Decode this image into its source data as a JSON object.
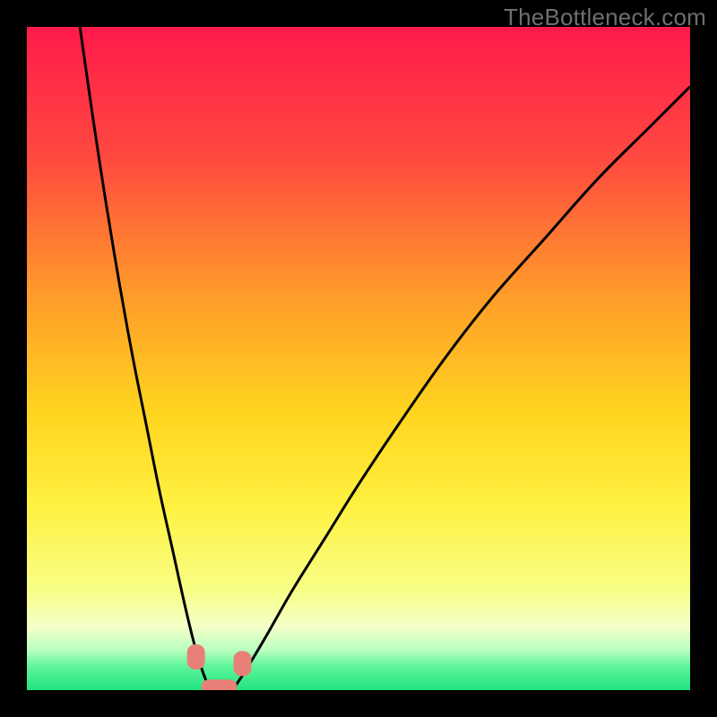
{
  "watermark": "TheBottleneck.com",
  "chart_data": {
    "type": "line",
    "title": "",
    "xlabel": "",
    "ylabel": "",
    "xlim": [
      0,
      100
    ],
    "ylim": [
      0,
      100
    ],
    "grid": false,
    "legend": false,
    "series": [
      {
        "name": "left-curve",
        "x": [
          8,
          10,
          12,
          14,
          16,
          18,
          20,
          22,
          24,
          25.5,
          27,
          28
        ],
        "y": [
          100,
          86,
          73,
          61,
          50,
          40,
          30,
          21,
          12,
          6,
          1.5,
          0
        ]
      },
      {
        "name": "right-curve",
        "x": [
          31,
          33,
          36,
          40,
          45,
          50,
          56,
          63,
          70,
          78,
          86,
          94,
          100
        ],
        "y": [
          0,
          3,
          8,
          15,
          23,
          31,
          40,
          50,
          59,
          68,
          77,
          85,
          91
        ]
      }
    ],
    "annotations": {
      "floor_band_color": "#2ae885",
      "markers": [
        {
          "name": "left-marker",
          "x": 25.5,
          "y": 5
        },
        {
          "name": "right-marker",
          "x": 32.5,
          "y": 4
        },
        {
          "name": "bottom-marker",
          "x": 29,
          "y": 0.5
        }
      ]
    },
    "background_gradient": {
      "stops": [
        {
          "pos": 0.0,
          "color": "#ff1a4b"
        },
        {
          "pos": 0.2,
          "color": "#ff4a3f"
        },
        {
          "pos": 0.4,
          "color": "#ff9a2a"
        },
        {
          "pos": 0.58,
          "color": "#ffd41f"
        },
        {
          "pos": 0.72,
          "color": "#fff140"
        },
        {
          "pos": 0.85,
          "color": "#f8ff87"
        },
        {
          "pos": 0.905,
          "color": "#f4ffc8"
        },
        {
          "pos": 0.94,
          "color": "#b8ffbf"
        },
        {
          "pos": 0.965,
          "color": "#5df59a"
        },
        {
          "pos": 1.0,
          "color": "#21e37f"
        }
      ]
    }
  }
}
